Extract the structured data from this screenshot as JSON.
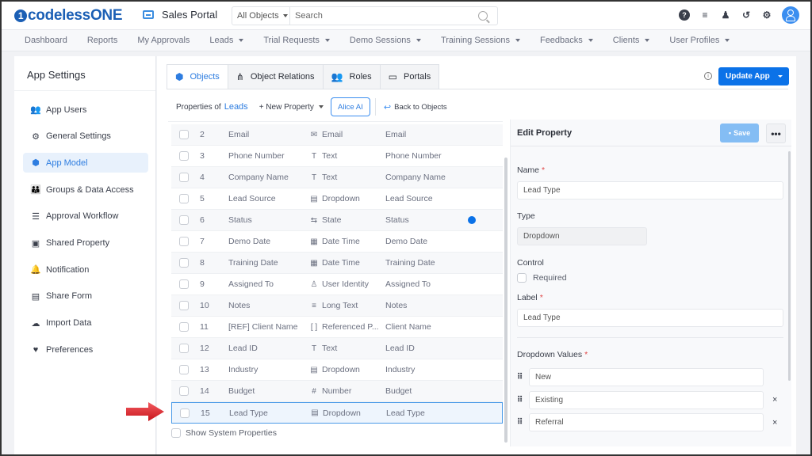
{
  "topbar": {
    "logo_mark": "1",
    "logo_text_a": "codeless",
    "logo_text_b": "ONE",
    "portal_name": "Sales Portal",
    "search_scope": "All Objects",
    "search_placeholder": "Search",
    "icons": [
      "help-icon",
      "database-icon",
      "add-user-icon",
      "history-icon",
      "gear-icon",
      "user-avatar"
    ]
  },
  "nav": {
    "items": [
      {
        "label": "Dashboard",
        "dropdown": false
      },
      {
        "label": "Reports",
        "dropdown": false
      },
      {
        "label": "My Approvals",
        "dropdown": false
      },
      {
        "label": "Leads",
        "dropdown": true
      },
      {
        "label": "Trial Requests",
        "dropdown": true
      },
      {
        "label": "Demo Sessions",
        "dropdown": true
      },
      {
        "label": "Training Sessions",
        "dropdown": true
      },
      {
        "label": "Feedbacks",
        "dropdown": true
      },
      {
        "label": "Clients",
        "dropdown": true
      },
      {
        "label": "User Profiles",
        "dropdown": true
      }
    ]
  },
  "sidebar": {
    "title": "App Settings",
    "items": [
      {
        "label": "App Users",
        "icon": "users-icon",
        "glyph": "👥",
        "active": false
      },
      {
        "label": "General Settings",
        "icon": "gear-icon",
        "glyph": "⚙",
        "active": false
      },
      {
        "label": "App Model",
        "icon": "cube-icon",
        "glyph": "⬢",
        "active": true
      },
      {
        "label": "Groups & Data Access",
        "icon": "groups-icon",
        "glyph": "👪",
        "active": false
      },
      {
        "label": "Approval Workflow",
        "icon": "checklist-icon",
        "glyph": "☰",
        "active": false
      },
      {
        "label": "Shared Property",
        "icon": "inbox-icon",
        "glyph": "▣",
        "active": false
      },
      {
        "label": "Notification",
        "icon": "bell-icon",
        "glyph": "🔔",
        "active": false
      },
      {
        "label": "Share Form",
        "icon": "form-icon",
        "glyph": "▤",
        "active": false
      },
      {
        "label": "Import Data",
        "icon": "cloud-upload-icon",
        "glyph": "☁",
        "active": false
      },
      {
        "label": "Preferences",
        "icon": "hand-heart-icon",
        "glyph": "♥",
        "active": false
      }
    ]
  },
  "main": {
    "tabs": [
      {
        "label": "Objects",
        "glyph": "⬢",
        "active": true
      },
      {
        "label": "Object Relations",
        "glyph": "⋔",
        "active": false
      },
      {
        "label": "Roles",
        "glyph": "👥",
        "active": false
      },
      {
        "label": "Portals",
        "glyph": "▭",
        "active": false
      }
    ],
    "update_button": "Update App",
    "properties_prefix": "Properties of",
    "object_name": "Leads",
    "new_property": "+ New Property",
    "alice_ai": "Alice AI",
    "back_to_objects": "Back to Objects",
    "show_system_properties": "Show System Properties",
    "table_rows": [
      {
        "num": "2",
        "name": "Email",
        "type": "Email",
        "type_glyph": "✉",
        "label": "Email",
        "dot": false,
        "selected": false
      },
      {
        "num": "3",
        "name": "Phone Number",
        "type": "Text",
        "type_glyph": "T",
        "label": "Phone Number",
        "dot": false,
        "selected": false
      },
      {
        "num": "4",
        "name": "Company Name",
        "type": "Text",
        "type_glyph": "T",
        "label": "Company Name",
        "dot": false,
        "selected": false
      },
      {
        "num": "5",
        "name": "Lead Source",
        "type": "Dropdown",
        "type_glyph": "▤",
        "label": "Lead Source",
        "dot": false,
        "selected": false
      },
      {
        "num": "6",
        "name": "Status",
        "type": "State",
        "type_glyph": "⇆",
        "label": "Status",
        "dot": true,
        "selected": false
      },
      {
        "num": "7",
        "name": "Demo Date",
        "type": "Date Time",
        "type_glyph": "▦",
        "label": "Demo Date",
        "dot": false,
        "selected": false
      },
      {
        "num": "8",
        "name": "Training Date",
        "type": "Date Time",
        "type_glyph": "▦",
        "label": "Training Date",
        "dot": false,
        "selected": false
      },
      {
        "num": "9",
        "name": "Assigned To",
        "type": "User Identity",
        "type_glyph": "♙",
        "label": "Assigned To",
        "dot": false,
        "selected": false
      },
      {
        "num": "10",
        "name": "Notes",
        "type": "Long Text",
        "type_glyph": "≡",
        "label": "Notes",
        "dot": false,
        "selected": false
      },
      {
        "num": "11",
        "name": "[REF] Client Name",
        "type": "Referenced P...",
        "type_glyph": "[ ]",
        "label": "Client Name",
        "dot": false,
        "selected": false
      },
      {
        "num": "12",
        "name": "Lead ID",
        "type": "Text",
        "type_glyph": "T",
        "label": "Lead ID",
        "dot": false,
        "selected": false
      },
      {
        "num": "13",
        "name": "Industry",
        "type": "Dropdown",
        "type_glyph": "▤",
        "label": "Industry",
        "dot": false,
        "selected": false
      },
      {
        "num": "14",
        "name": "Budget",
        "type": "Number",
        "type_glyph": "#",
        "label": "Budget",
        "dot": false,
        "selected": false
      },
      {
        "num": "15",
        "name": "Lead Type",
        "type": "Dropdown",
        "type_glyph": "▤",
        "label": "Lead Type",
        "dot": false,
        "selected": true
      }
    ]
  },
  "edit_panel": {
    "title": "Edit Property",
    "save_label": "Save",
    "more_label": "•••",
    "name_label": "Name",
    "name_value": "Lead Type",
    "type_label": "Type",
    "type_value": "Dropdown",
    "control_label": "Control",
    "required_label": "Required",
    "required_checked": false,
    "label_label": "Label",
    "label_value": "Lead Type",
    "dropdown_values_label": "Dropdown Values",
    "required_mark": "*",
    "dropdown_values": [
      {
        "value": "New",
        "removable": false
      },
      {
        "value": "Existing",
        "removable": true
      },
      {
        "value": "Referral",
        "removable": true
      }
    ],
    "remove_glyph": "×",
    "grip_glyph": "⠿"
  },
  "annotation": {
    "arrow_color": "#e0242b"
  }
}
